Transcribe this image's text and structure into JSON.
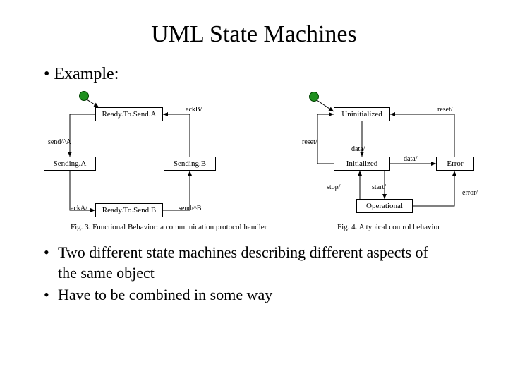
{
  "title": "UML State Machines",
  "bullet1": "Example:",
  "left": {
    "states": {
      "readyA": "Ready.To.Send.A",
      "sendingA": "Sending.A",
      "sendingB": "Sending.B",
      "readyB": "Ready.To.Send.B"
    },
    "labels": {
      "ackB": "ackB/",
      "sendA": "send/^A",
      "ackA": "ackA/",
      "sendB": "send/^B"
    },
    "caption": "Fig. 3. Functional Behavior: a communication protocol handler"
  },
  "right": {
    "states": {
      "uninitialized": "Uninitialized",
      "initialized": "Initialized",
      "error": "Error",
      "operational": "Operational"
    },
    "labels": {
      "reset1": "reset/",
      "reset2": "reset/",
      "data1": "data/",
      "data2": "data/",
      "stop": "stop/",
      "start": "start/",
      "error": "error/"
    },
    "caption": "Fig. 4. A typical control behavior"
  },
  "body": {
    "b1l1": "Two different state machines describing different aspects of",
    "b1l2": "the same object",
    "b2": "Have to be combined in some way"
  }
}
